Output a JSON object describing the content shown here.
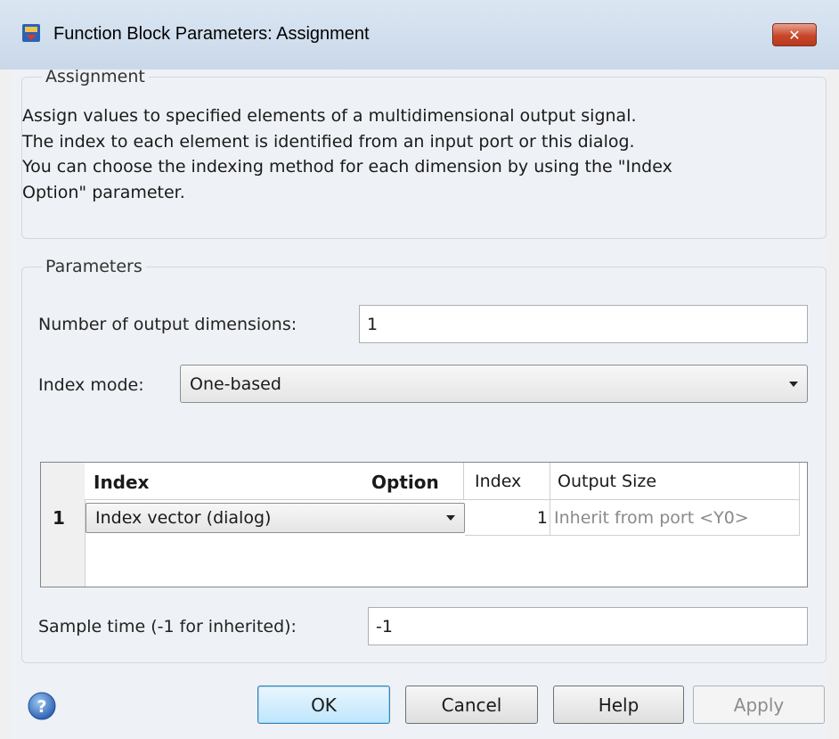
{
  "window": {
    "title": "Function Block Parameters: Assignment",
    "close_glyph": "✕"
  },
  "assignment_group": {
    "legend": "Assignment",
    "description_lines": [
      "Assign values to specified elements of a multidimensional output signal.",
      "The index to each element is identified from an input port or this dialog.",
      "You can choose the indexing method for each dimension by using the \"Index",
      "Option\" parameter."
    ]
  },
  "parameters_group": {
    "legend": "Parameters",
    "num_dims_label": "Number of output dimensions:",
    "num_dims_value": "1",
    "index_mode_label": "Index mode:",
    "index_mode_value": "One-based",
    "table": {
      "headers": {
        "col_index": "Index",
        "col_option": "Option",
        "col_index2": "Index",
        "col_output": "Output Size"
      },
      "rows": [
        {
          "row_num": "1",
          "option": "Index vector (dialog)",
          "index": "1",
          "output_size": "Inherit from port <Y0>"
        }
      ]
    },
    "sample_time_label": "Sample time (-1 for inherited):",
    "sample_time_value": "-1"
  },
  "buttons": {
    "ok": "OK",
    "cancel": "Cancel",
    "help": "Help",
    "apply": "Apply"
  },
  "colors": {
    "accent": "#3c7fb1",
    "close_red": "#c8462b",
    "disabled_text": "#8c8c8c"
  },
  "icons": {
    "app": "simulink-block-icon",
    "help": "question-icon",
    "close": "close-icon"
  }
}
